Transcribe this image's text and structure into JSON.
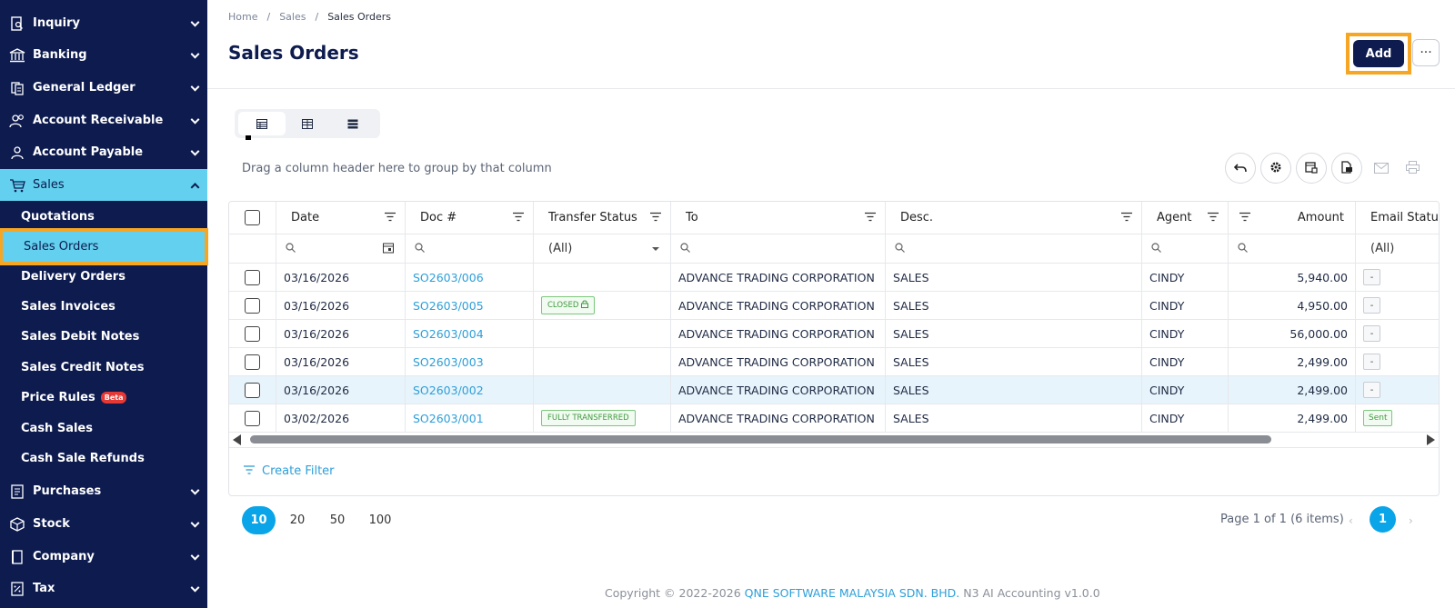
{
  "sidebar": {
    "items": [
      {
        "label": "Inquiry",
        "icon": "inquiry-icon"
      },
      {
        "label": "Banking",
        "icon": "bank-icon"
      },
      {
        "label": "General Ledger",
        "icon": "ledger-icon"
      },
      {
        "label": "Account Receivable",
        "icon": "receivable-icon"
      },
      {
        "label": "Account Payable",
        "icon": "payable-icon"
      },
      {
        "label": "Sales",
        "icon": "cart-icon",
        "active": true
      },
      {
        "label": "Purchases",
        "icon": "purchases-icon"
      },
      {
        "label": "Stock",
        "icon": "box-icon"
      },
      {
        "label": "Company",
        "icon": "company-icon"
      },
      {
        "label": "Tax",
        "icon": "tax-icon"
      }
    ],
    "sales_sub": [
      {
        "label": "Quotations"
      },
      {
        "label": "Sales Orders",
        "selected": true
      },
      {
        "label": "Delivery Orders"
      },
      {
        "label": "Sales Invoices"
      },
      {
        "label": "Sales Debit Notes"
      },
      {
        "label": "Sales Credit Notes"
      },
      {
        "label": "Price Rules",
        "badge": "Beta"
      },
      {
        "label": "Cash Sales"
      },
      {
        "label": "Cash Sale Refunds"
      }
    ]
  },
  "breadcrumb": {
    "home": "Home",
    "sep": "/",
    "sales": "Sales",
    "current": "Sales Orders"
  },
  "page": {
    "title": "Sales Orders",
    "add_label": "Add",
    "more_label": "···"
  },
  "grid": {
    "group_hint": "Drag a column header here to group by that column",
    "columns": [
      "Date",
      "Doc #",
      "Transfer Status",
      "To",
      "Desc.",
      "Agent",
      "Amount",
      "Email Status"
    ],
    "filter_all": "(All)",
    "rows": [
      {
        "date": "03/16/2026",
        "doc": "SO2603/006",
        "transfer": "",
        "to": "ADVANCE TRADING CORPORATION",
        "desc": "SALES",
        "agent": "CINDY",
        "amount": "5,940.00",
        "email": "-"
      },
      {
        "date": "03/16/2026",
        "doc": "SO2603/005",
        "transfer": "CLOSED",
        "to": "ADVANCE TRADING CORPORATION",
        "desc": "SALES",
        "agent": "CINDY",
        "amount": "4,950.00",
        "email": "-"
      },
      {
        "date": "03/16/2026",
        "doc": "SO2603/004",
        "transfer": "",
        "to": "ADVANCE TRADING CORPORATION",
        "desc": "SALES",
        "agent": "CINDY",
        "amount": "56,000.00",
        "email": "-"
      },
      {
        "date": "03/16/2026",
        "doc": "SO2603/003",
        "transfer": "",
        "to": "ADVANCE TRADING CORPORATION",
        "desc": "SALES",
        "agent": "CINDY",
        "amount": "2,499.00",
        "email": "-"
      },
      {
        "date": "03/16/2026",
        "doc": "SO2603/002",
        "transfer": "",
        "to": "ADVANCE TRADING CORPORATION",
        "desc": "SALES",
        "agent": "CINDY",
        "amount": "2,499.00",
        "email": "-"
      },
      {
        "date": "03/02/2026",
        "doc": "SO2603/001",
        "transfer": "FULLY TRANSFERRED",
        "to": "ADVANCE TRADING CORPORATION",
        "desc": "SALES",
        "agent": "CINDY",
        "amount": "2,499.00",
        "email": "Sent"
      }
    ]
  },
  "create_filter": "Create Filter",
  "pagination": {
    "sizes": [
      "10",
      "20",
      "50",
      "100"
    ],
    "active_size": "10",
    "info": "Page 1 of 1 (6 items)",
    "current_page": "1",
    "prev": "‹",
    "next": "›"
  },
  "footer": {
    "prefix": "Copyright © 2022-2026 ",
    "company": "QNE SOFTWARE MALAYSIA SDN. BHD.",
    "suffix": " N3 AI Accounting v1.0.0"
  },
  "colors": {
    "sidebar": "#0d1b4f",
    "active": "#62d0ee",
    "highlight": "#f6a623",
    "link": "#2d9fd9",
    "primary": "#0aa4e8"
  }
}
